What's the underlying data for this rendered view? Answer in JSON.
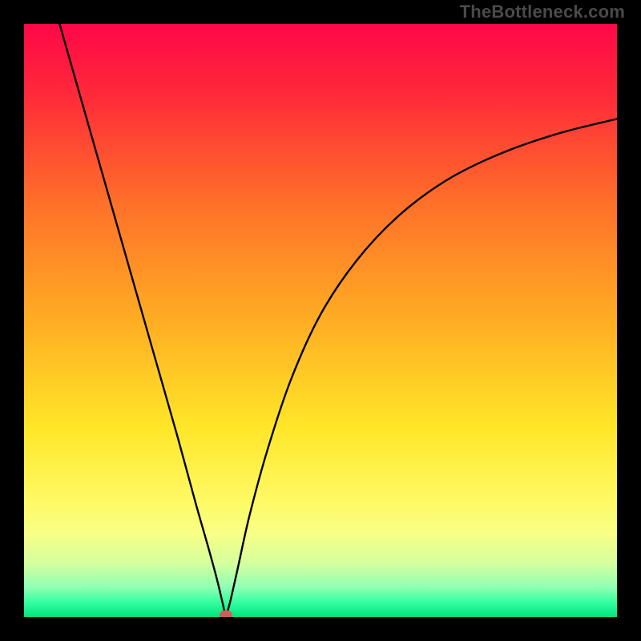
{
  "watermark": "TheBottleneck.com",
  "colors": {
    "frame_bg": "#000000",
    "curve": "#000000",
    "marker": "#cd6155",
    "gradient_stops": [
      {
        "offset": 0.0,
        "color": "#ff0748"
      },
      {
        "offset": 0.12,
        "color": "#ff2a39"
      },
      {
        "offset": 0.3,
        "color": "#ff6f2a"
      },
      {
        "offset": 0.5,
        "color": "#ffad23"
      },
      {
        "offset": 0.68,
        "color": "#ffe628"
      },
      {
        "offset": 0.8,
        "color": "#fff963"
      },
      {
        "offset": 0.86,
        "color": "#f8ff86"
      },
      {
        "offset": 0.91,
        "color": "#d4ff9e"
      },
      {
        "offset": 0.95,
        "color": "#8fffb4"
      },
      {
        "offset": 0.975,
        "color": "#35ffa0"
      },
      {
        "offset": 1.0,
        "color": "#00e57e"
      }
    ]
  },
  "chart_data": {
    "type": "line",
    "title": "",
    "xlabel": "",
    "ylabel": "",
    "xlim": [
      0,
      100
    ],
    "ylim": [
      0,
      100
    ],
    "marker": {
      "x": 34,
      "y": 0
    },
    "series": [
      {
        "name": "left-branch",
        "x": [
          6,
          10,
          14,
          18,
          22,
          26,
          29,
          31,
          32.5,
          33.5,
          34
        ],
        "y": [
          100,
          86,
          72,
          58,
          44,
          30,
          19,
          12,
          6.5,
          2.3,
          0
        ]
      },
      {
        "name": "right-branch",
        "x": [
          34,
          34.7,
          36,
          38,
          41,
          45,
          50,
          56,
          63,
          71,
          80,
          90,
          100
        ],
        "y": [
          0,
          2.3,
          8,
          17,
          28,
          40,
          51,
          60,
          67.5,
          73.5,
          78,
          81.5,
          84
        ]
      }
    ]
  }
}
